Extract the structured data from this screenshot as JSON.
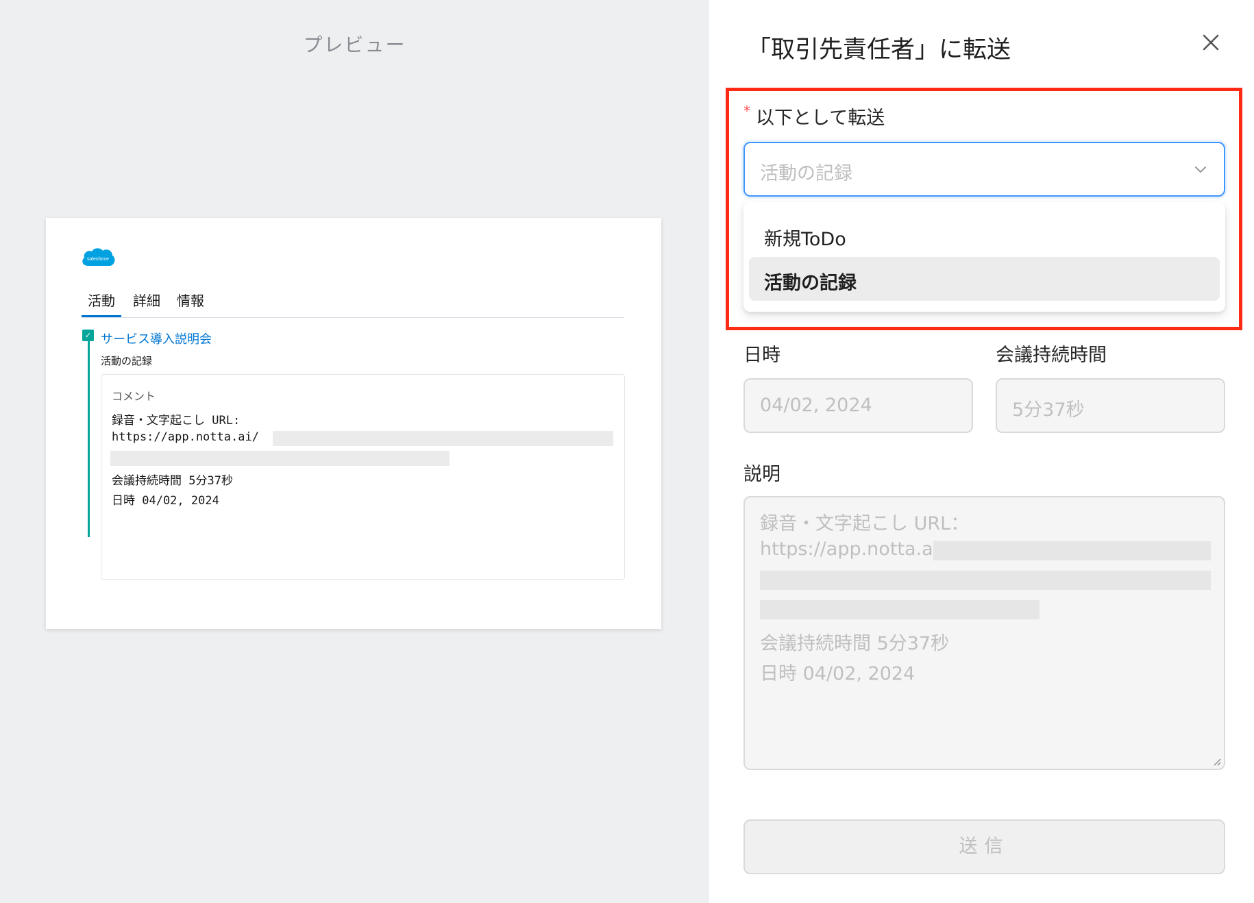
{
  "preview": {
    "title": "プレビュー",
    "logo_text": "salesforce",
    "tabs": [
      "活動",
      "詳細",
      "情報"
    ],
    "event_title": "サービス導入説明会",
    "event_subtitle": "活動の記録",
    "comment_label": "コメント",
    "comment_lines": [
      "録音・文字起こし URL:",
      "https://app.notta.ai/",
      "会議持続時間 5分37秒",
      "日時 04/02, 2024"
    ]
  },
  "drawer": {
    "title": "「取引先責任者」に転送",
    "forward_as": {
      "required_mark": "*",
      "label": "以下として転送",
      "placeholder": "活動の記録",
      "options": [
        {
          "label": "新規ToDo",
          "selected": false
        },
        {
          "label": "活動の記録",
          "selected": true
        }
      ]
    },
    "date": {
      "label": "日時",
      "value": "04/02, 2024"
    },
    "duration": {
      "label": "会議持続時間",
      "value": "5分37秒"
    },
    "description": {
      "label": "説明",
      "lines": [
        "録音・文字起こし URL：",
        "https://app.notta.ai/",
        "会議持続時間 5分37秒",
        "日時 04/02, 2024"
      ]
    },
    "submit_label": "送信"
  },
  "colors": {
    "preview_bg": "#eeeff1",
    "highlight": "#ff2a14",
    "select_focus": "#4096ff",
    "salesforce_blue": "#00a1e0",
    "link_blue": "#0176d3",
    "timeline_teal": "#06a59a"
  },
  "icons": {
    "close": "close-icon",
    "chevron": "chevron-down-icon",
    "logo": "salesforce-logo",
    "task": "task-icon"
  }
}
